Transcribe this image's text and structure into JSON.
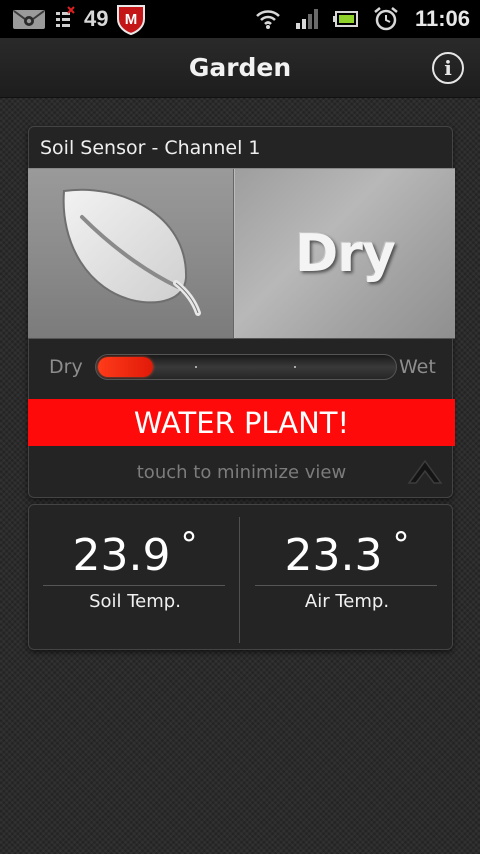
{
  "status_bar": {
    "notification_count": "49",
    "time": "11:06",
    "icons": [
      "mail-icon",
      "usb-debug-icon",
      "mcafee-icon",
      "wifi-icon",
      "signal-icon",
      "battery-icon",
      "alarm-icon"
    ]
  },
  "title_bar": {
    "title": "Garden",
    "info_label": "i"
  },
  "sensor_card": {
    "header": "Soil Sensor - Channel 1",
    "status_word": "Dry",
    "scale_min_label": "Dry",
    "scale_max_label": "Wet",
    "moisture_level": 0.19,
    "alert_text": "WATER PLANT!",
    "minimize_hint": "touch to minimize view"
  },
  "temperature_card": {
    "soil": {
      "value": "23.9",
      "unit": "°",
      "label": "Soil Temp."
    },
    "air": {
      "value": "23.3",
      "unit": "°",
      "label": "Air Temp."
    }
  },
  "colors": {
    "alert_red": "#ff0a0a",
    "moisture_fill": "#ff3b1a",
    "background": "#2b2b2b"
  }
}
